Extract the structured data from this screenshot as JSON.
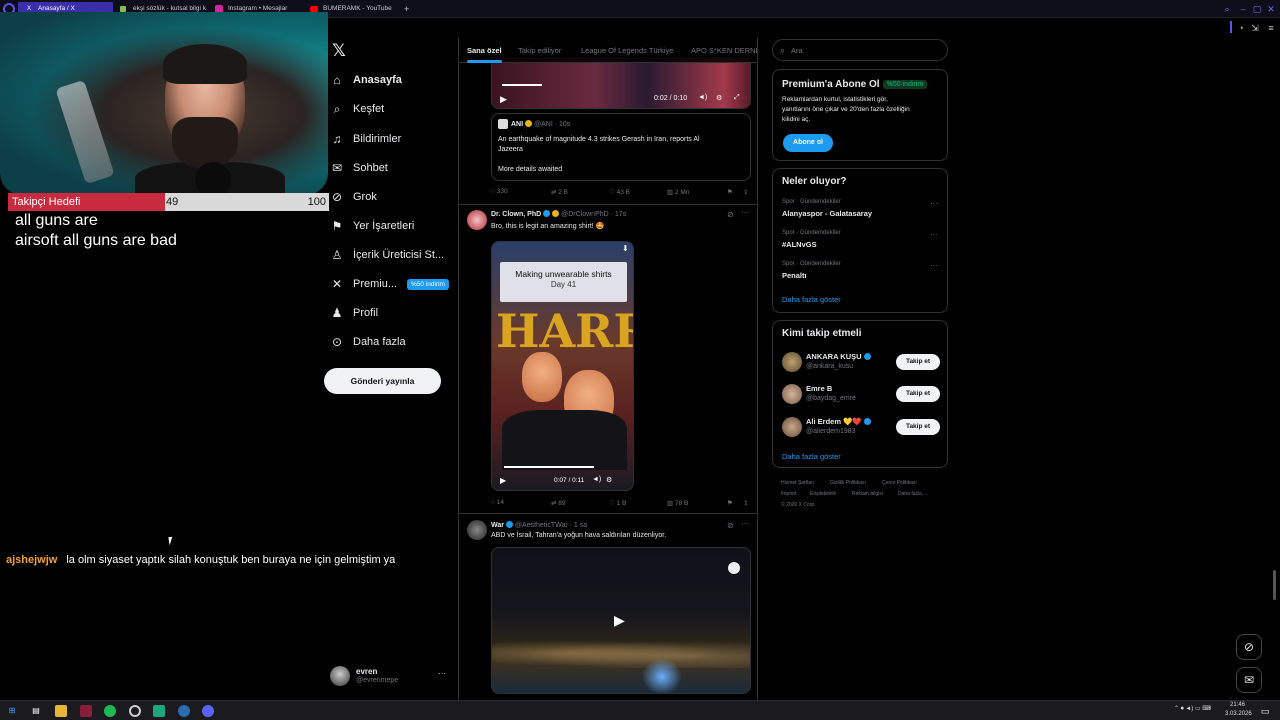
{
  "browser": {
    "tabs": [
      {
        "title": "Anasayfa / X",
        "icon": "x-logo-icon",
        "active": true
      },
      {
        "title": "ekşi sözlük - kutsal bilgi k",
        "icon": "eksi-icon",
        "active": false
      },
      {
        "title": "Instagram • Mesajlar",
        "icon": "instagram-icon",
        "active": false
      },
      {
        "title": "BUMERAMK - YouTube",
        "icon": "youtube-icon",
        "active": false
      }
    ],
    "new_tab": "+"
  },
  "stream": {
    "goal_label": "Takipçi Hedefi",
    "goal_current": "49",
    "goal_max": "100",
    "goal_fraction": 0.49,
    "caption_line1": "all guns are",
    "caption_line2": "airsoft all guns are bad",
    "chat_user": "ajshejwjw",
    "chat_message": "la olm siyaset yaptık silah konuştuk ben buraya ne için gelmiştim ya"
  },
  "nav": {
    "items": [
      {
        "label": "Anasayfa",
        "icon": "home-icon"
      },
      {
        "label": "Keşfet",
        "icon": "search-icon"
      },
      {
        "label": "Bildirimler",
        "icon": "bell-icon"
      },
      {
        "label": "Sohbet",
        "icon": "mail-icon"
      },
      {
        "label": "Grok",
        "icon": "grok-icon"
      },
      {
        "label": "Yer İşaretleri",
        "icon": "bookmark-icon"
      },
      {
        "label": "İçerik Üreticisi St...",
        "icon": "creator-icon"
      },
      {
        "label": "Premiu...",
        "icon": "x-premium-icon"
      },
      {
        "label": "Profil",
        "icon": "profile-icon"
      },
      {
        "label": "Daha fazla",
        "icon": "more-icon"
      }
    ],
    "premium_badge": "%50 indirim",
    "post_button": "Gönderi yayınla",
    "account_name": "evren",
    "account_handle": "@evrenntepe",
    "account_menu": "···"
  },
  "feed": {
    "tabs": [
      "Sana özel",
      "Takip ediliyor",
      "League Of Legends Türkiye",
      "APO S*KEN DERNE"
    ],
    "post1": {
      "video_time": "0:02 / 0:10",
      "quote_name": "ANI",
      "quote_meta": "@ANI · 10s",
      "quote_text_1": "An earthquake of magnitude 4.3 strikes Gerash in Iran, reports Al",
      "quote_text_2": "Jazeera",
      "quote_more": "More details awaited",
      "replies": "330",
      "reposts": "2 B",
      "likes": "43 B",
      "views": "2 Mn"
    },
    "post2": {
      "name": "Dr. Clown, PhD",
      "meta": "@DrClownPhD · 17s",
      "text": "Bro, this is legit an amazing shirt! 🤩",
      "media_title": "Making unwearable shirts",
      "media_sub": "Day 41",
      "video_time": "0:07 / 0:11",
      "replies": "14",
      "reposts": "89",
      "likes": "1 B",
      "views": "78 B"
    },
    "post3": {
      "name": "War",
      "meta": "@AestheticTWar · 1 sa",
      "text": "ABD ve İsrail, Tahran'a yoğun hava saldırıları düzenliyor."
    }
  },
  "right": {
    "search_placeholder": "Ara",
    "premium_title": "Premium'a Abone Ol",
    "premium_pill": "%50 indirim",
    "premium_text_1": "Reklamlardan kurtul, istatistikleri gör,",
    "premium_text_2": "yanıtlarını öne çıkar ve 20'den fazla özelliğin",
    "premium_text_3": "kilidini aç.",
    "premium_button": "Abone ol",
    "trends_title": "Neler oluyor?",
    "trends": [
      {
        "cat": "Spor · Gündemdekiler",
        "topic": "Alanyaspor - Galatasaray"
      },
      {
        "cat": "Spor · Gündemdekiler",
        "topic": "#ALNvGS"
      },
      {
        "cat": "Spor · Gündemdekiler",
        "topic": "Penaltı"
      }
    ],
    "show_more": "Daha fazla göster",
    "who_title": "Kimi takip etmeli",
    "suggestions": [
      {
        "name": "ANKARA KUŞU",
        "handle": "@ankara_kusu",
        "button": "Takip et"
      },
      {
        "name": "Emre B",
        "handle": "@baydag_emre",
        "button": "Takip et"
      },
      {
        "name": "Ali Erdem 💛❤️",
        "handle": "@alierdem1983",
        "button": "Takip et"
      }
    ],
    "footer": [
      "Hizmet Şartları",
      "Gizlilik Politikası",
      "Çerez Politikası",
      "Imprint",
      "Erişilebilirlik",
      "Reklam bilgisi",
      "Daha fazla ...",
      "© 2026 X Corp."
    ]
  },
  "taskbar": {
    "time": "21:46",
    "date": "3.03.2026"
  }
}
